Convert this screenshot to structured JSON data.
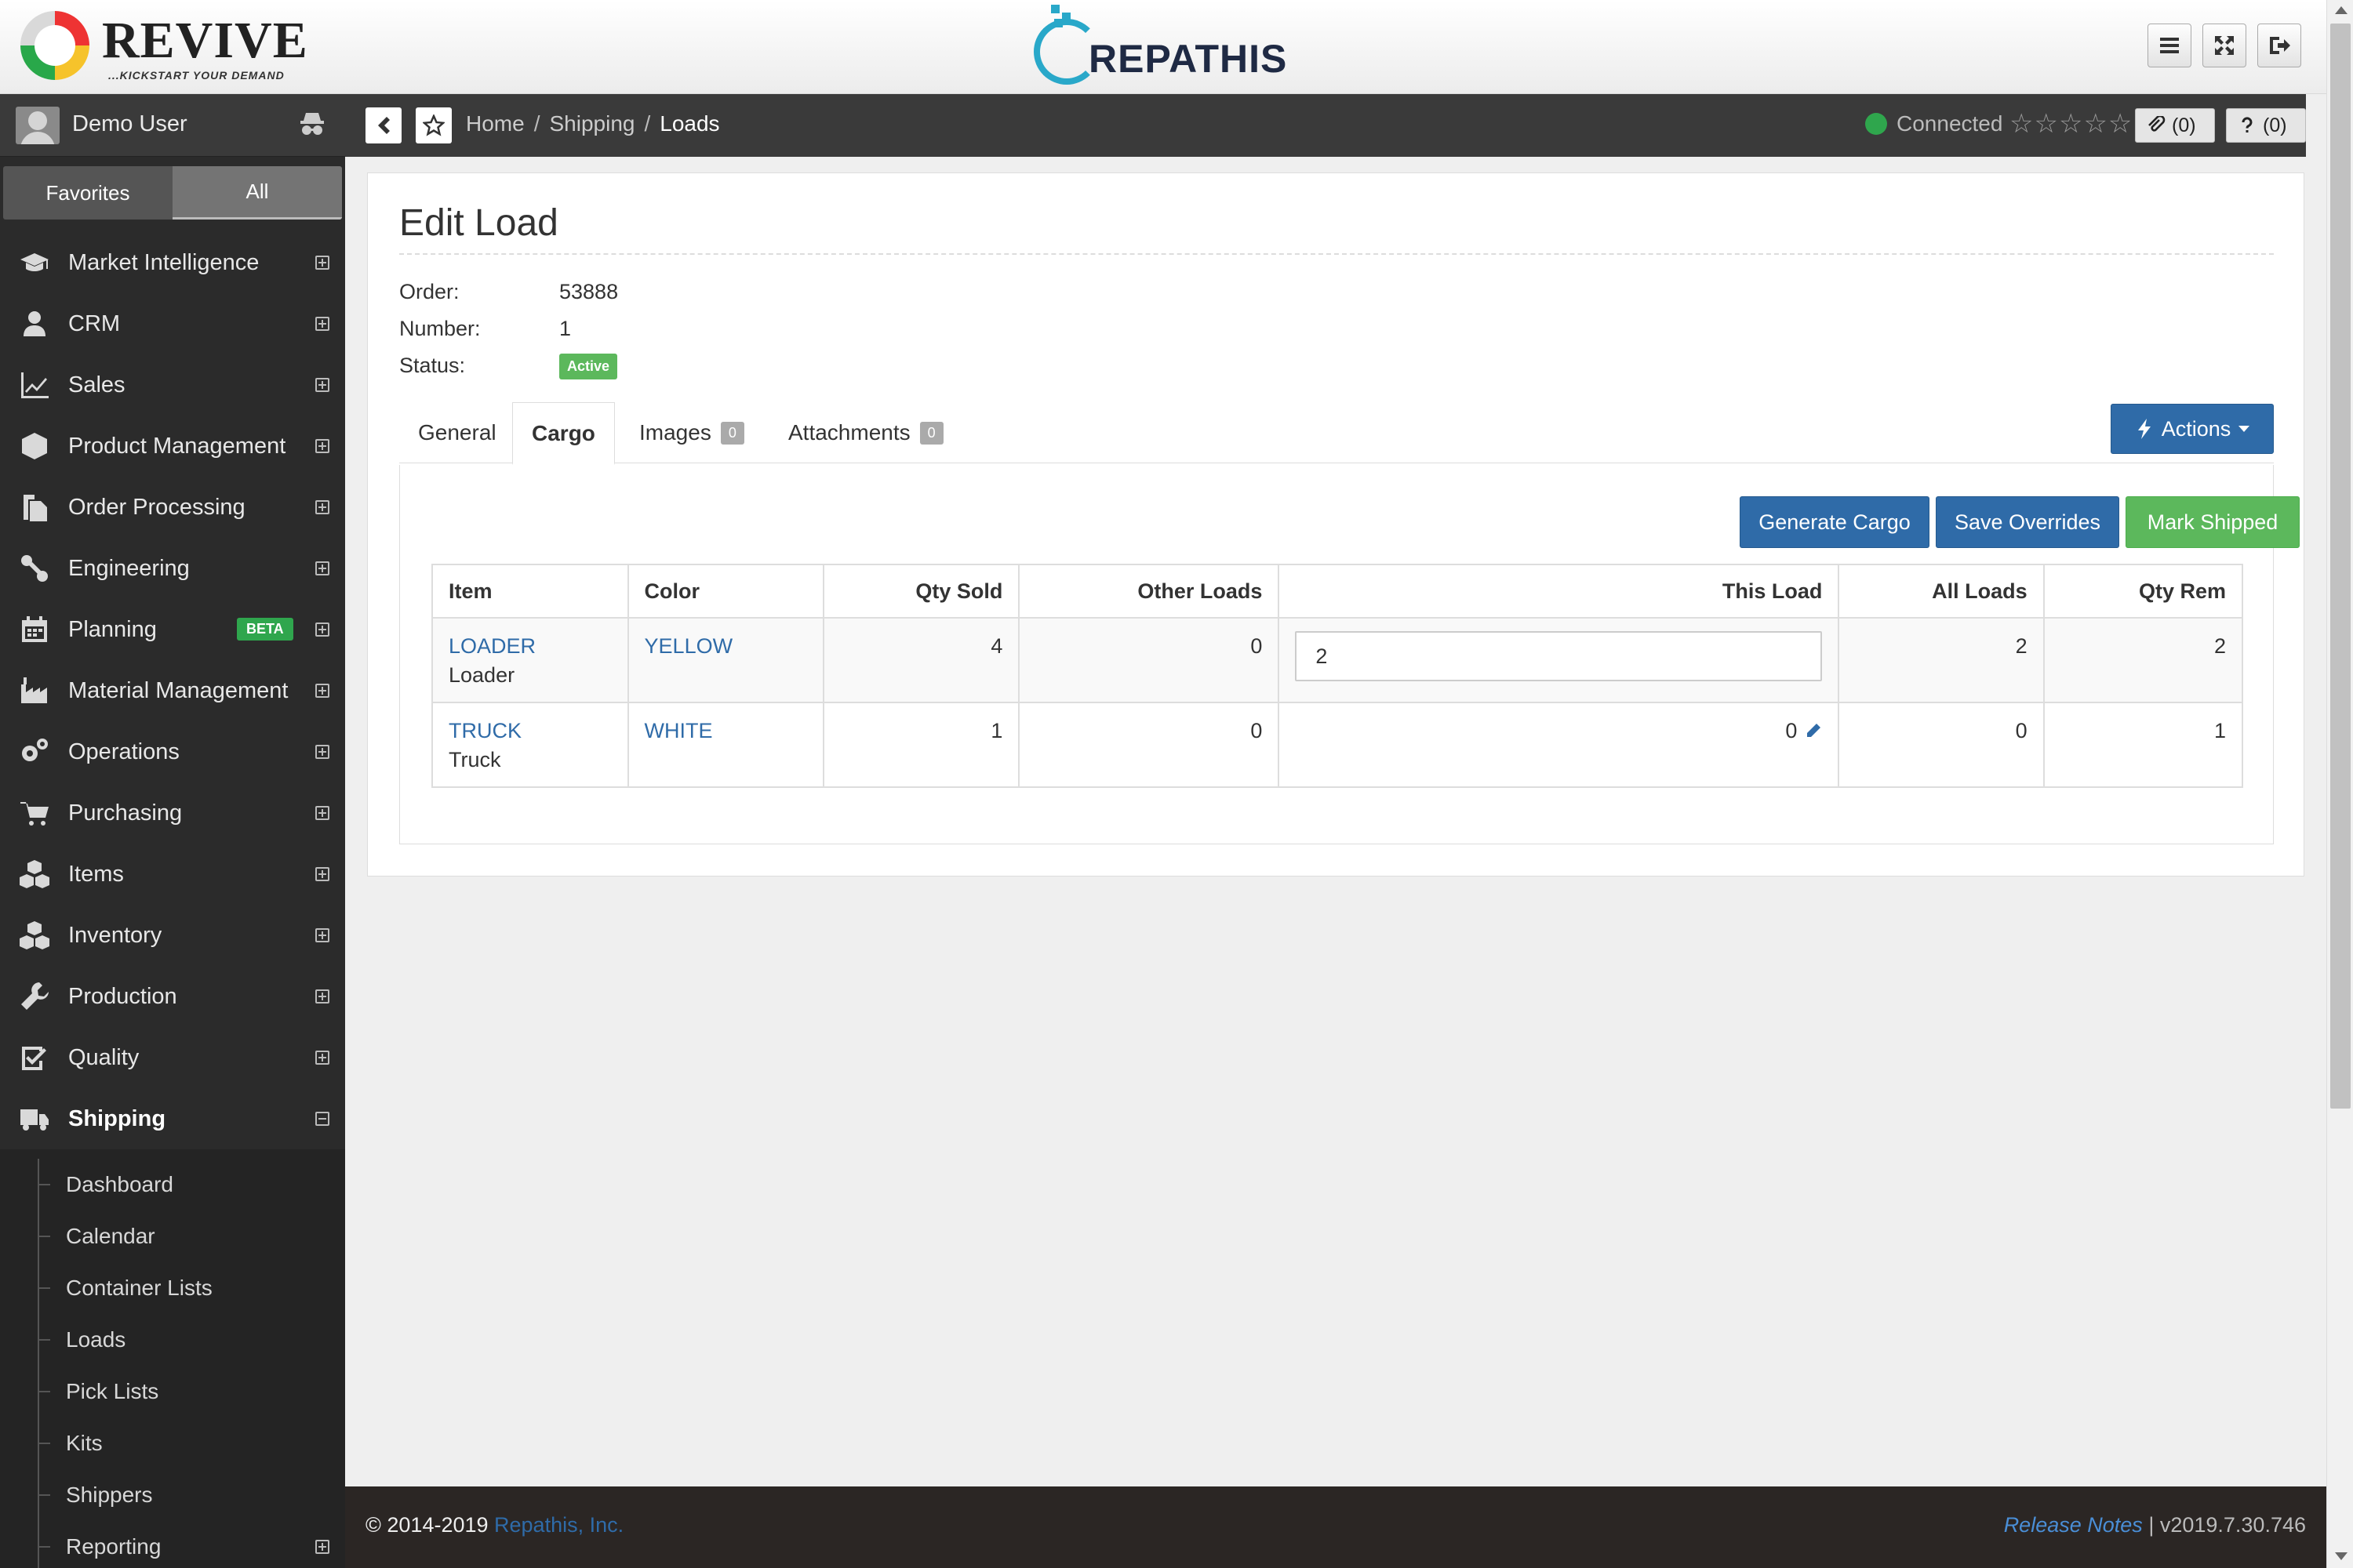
{
  "brand": {
    "left_logo": "REVIVE",
    "left_tagline": "...KICKSTART YOUR DEMAND",
    "center_logo": "REPATHIS"
  },
  "sidebar": {
    "user_name": "Demo User",
    "tabs": [
      "Favorites",
      "All"
    ],
    "items": [
      {
        "label": "Market Intelligence",
        "icon": "graduation-cap-icon"
      },
      {
        "label": "CRM",
        "icon": "user-icon"
      },
      {
        "label": "Sales",
        "icon": "line-chart-icon"
      },
      {
        "label": "Product Management",
        "icon": "cube-icon"
      },
      {
        "label": "Order Processing",
        "icon": "files-icon"
      },
      {
        "label": "Engineering",
        "icon": "wrench-link-icon"
      },
      {
        "label": "Planning",
        "icon": "calendar-icon",
        "badge": "BETA"
      },
      {
        "label": "Material Management",
        "icon": "factory-icon"
      },
      {
        "label": "Operations",
        "icon": "gears-icon"
      },
      {
        "label": "Purchasing",
        "icon": "cart-icon"
      },
      {
        "label": "Items",
        "icon": "cubes-icon"
      },
      {
        "label": "Inventory",
        "icon": "boxes-icon"
      },
      {
        "label": "Production",
        "icon": "wrench-icon"
      },
      {
        "label": "Quality",
        "icon": "check-square-icon"
      },
      {
        "label": "Shipping",
        "icon": "truck-icon"
      }
    ],
    "shipping_sub": [
      "Dashboard",
      "Calendar",
      "Container Lists",
      "Loads",
      "Pick Lists",
      "Kits",
      "Shippers",
      "Reporting"
    ]
  },
  "breadcrumb": {
    "home": "Home",
    "section": "Shipping",
    "current": "Loads"
  },
  "status": {
    "text": "Connected",
    "rating": "☆☆☆☆☆",
    "color": "#2fa64d"
  },
  "counters": {
    "attachments": "(0)",
    "help": "(0)"
  },
  "page": {
    "title": "Edit Load",
    "order_label": "Order:",
    "order_value": "53888",
    "number_label": "Number:",
    "number_value": "1",
    "status_label": "Status:",
    "status_value": "Active",
    "tabs": {
      "general": "General",
      "cargo": "Cargo",
      "images": "Images",
      "images_count": "0",
      "attachments": "Attachments",
      "attachments_count": "0"
    },
    "actions_label": "Actions",
    "buttons": {
      "generate": "Generate Cargo",
      "save": "Save Overrides",
      "shipped": "Mark Shipped"
    }
  },
  "table": {
    "headers": [
      "Item",
      "Color",
      "Qty Sold",
      "Other Loads",
      "This Load",
      "All Loads",
      "Qty Rem"
    ],
    "rows": [
      {
        "item": "LOADER",
        "item_desc": "Loader",
        "color": "YELLOW",
        "qty_sold": "4",
        "other_loads": "0",
        "this_load": "2",
        "all_loads": "2",
        "qty_rem": "2"
      },
      {
        "item": "TRUCK",
        "item_desc": "Truck",
        "color": "WHITE",
        "qty_sold": "1",
        "other_loads": "0",
        "this_load": "0",
        "all_loads": "0",
        "qty_rem": "1"
      }
    ]
  },
  "footer": {
    "copyright": "© 2014-2019",
    "company": "Repathis, Inc.",
    "release_notes": "Release Notes",
    "version": "| v2019.7.30.746"
  },
  "colors": {
    "primary": "#2f6ba8",
    "success": "#5cb85c",
    "sidebar": "#2b2b2b"
  }
}
